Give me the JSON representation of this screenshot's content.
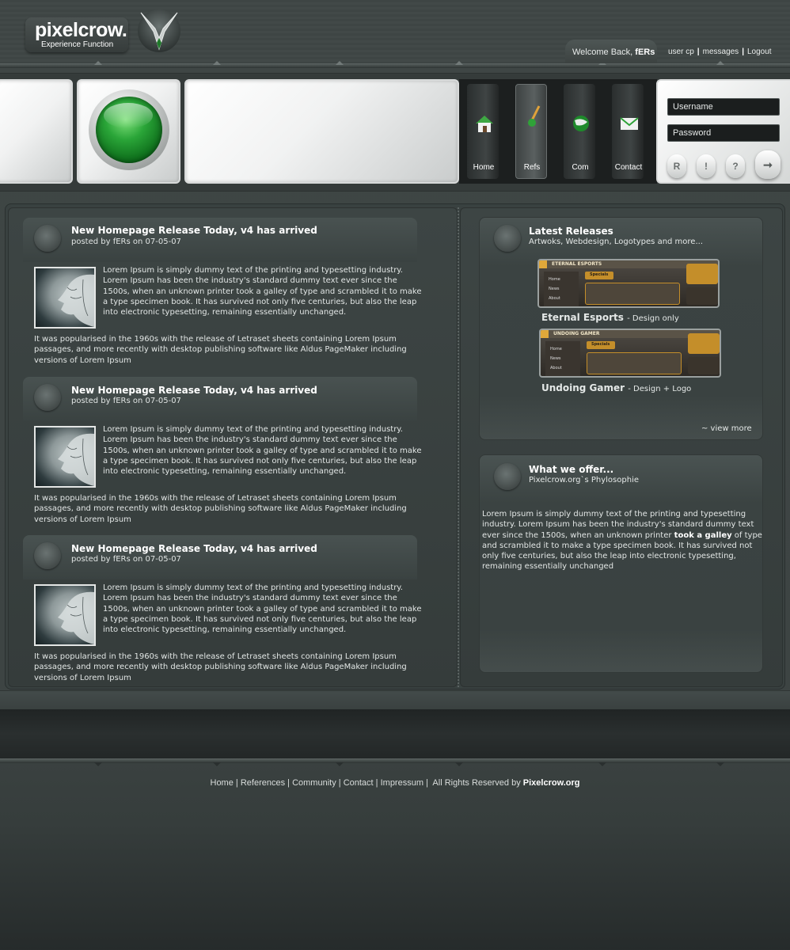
{
  "header": {
    "logo": "pixelcrow.",
    "tagline": "Experience Function",
    "welcome_prefix": "Welcome Back,",
    "username": "fERs",
    "links": [
      "user cp",
      "messages",
      "Logout"
    ]
  },
  "nav": {
    "items": [
      {
        "label": "Home",
        "icon": "house-icon"
      },
      {
        "label": "Refs",
        "icon": "pencil-icon"
      },
      {
        "label": "Com",
        "icon": "globe-icon"
      },
      {
        "label": "Contact",
        "icon": "envelope-icon"
      }
    ],
    "active": "Refs"
  },
  "login": {
    "username_placeholder": "Username",
    "password_placeholder": "Password",
    "buttons": [
      "R",
      "!",
      "?"
    ],
    "go": "➞"
  },
  "posts": [
    {
      "title": "New Homepage Release Today, v4 has arrived",
      "meta": "posted by fERs on 07-05-07",
      "body": "Lorem Ipsum is simply dummy text of the printing and typesetting industry. Lorem Ipsum has been the industry's standard dummy text ever since the 1500s, when an unknown printer took a galley of type and scrambled it to make a type specimen book. It has survived not only five centuries, but also the leap into electronic typesetting, remaining essentially unchanged.",
      "foot": "It was popularised in the 1960s with the release of Letraset sheets containing Lorem Ipsum passages, and more recently with desktop publishing software like Aldus PageMaker including versions of Lorem Ipsum"
    },
    {
      "title": "New Homepage Release Today, v4 has arrived",
      "meta": "posted by fERs on 07-05-07",
      "body": "Lorem Ipsum is simply dummy text of the printing and typesetting industry. Lorem Ipsum has been the industry's standard dummy text ever since the 1500s, when an unknown printer took a galley of type and scrambled it to make a type specimen book. It has survived not only five centuries, but also the leap into electronic typesetting, remaining essentially unchanged.",
      "foot": "It was popularised in the 1960s with the release of Letraset sheets containing Lorem Ipsum passages, and more recently with desktop publishing software like Aldus PageMaker including versions of Lorem Ipsum"
    },
    {
      "title": "New Homepage Release Today, v4 has arrived",
      "meta": "posted by fERs on 07-05-07",
      "body": "Lorem Ipsum is simply dummy text of the printing and typesetting industry. Lorem Ipsum has been the industry's standard dummy text ever since the 1500s, when an unknown printer took a galley of type and scrambled it to make a type specimen book. It has survived not only five centuries, but also the leap into electronic typesetting, remaining essentially unchanged.",
      "foot": "It was popularised in the 1960s with the release of Letraset sheets containing Lorem Ipsum passages, and more recently with desktop publishing software like Aldus PageMaker including versions of Lorem Ipsum"
    }
  ],
  "releases": {
    "title": "Latest Releases",
    "subtitle": "Artwoks, Webdesign, Logotypes and more...",
    "items": [
      {
        "name": "Eternal Esports",
        "type": "- Design only",
        "shot_text": "ETERNAL ESPORTS"
      },
      {
        "name": "Undoing Gamer",
        "type": "- Design + Logo",
        "shot_text": "UNDOING GAMER"
      }
    ],
    "shot_nav": [
      "Home",
      "News",
      "About"
    ],
    "shot_tab": "Specials",
    "view_more": "~ view more"
  },
  "offer": {
    "title": "What we offer...",
    "subtitle": "Pixelcrow.org`s Phylosophie",
    "text_before": "Lorem Ipsum is simply dummy text of the printing and typesetting industry. Lorem Ipsum has been the industry's standard dummy text ever since the 1500s, when an unknown printer ",
    "text_bold": "took a galley",
    "text_after": " of type and scrambled it to make a type specimen book. It has survived not only five centuries, but also the leap into electronic typesetting, remaining essentially unchanged"
  },
  "footer": {
    "links": [
      "Home",
      "References",
      "Community",
      "Contact",
      "Impressum"
    ],
    "rights": "All Rights Reserved by",
    "site": "Pixelcrow.org"
  },
  "colors": {
    "background": "#3e4544",
    "accent_green": "#2aa538",
    "panel_white": "#f1f2f2",
    "text_light": "#e2e6e5"
  }
}
